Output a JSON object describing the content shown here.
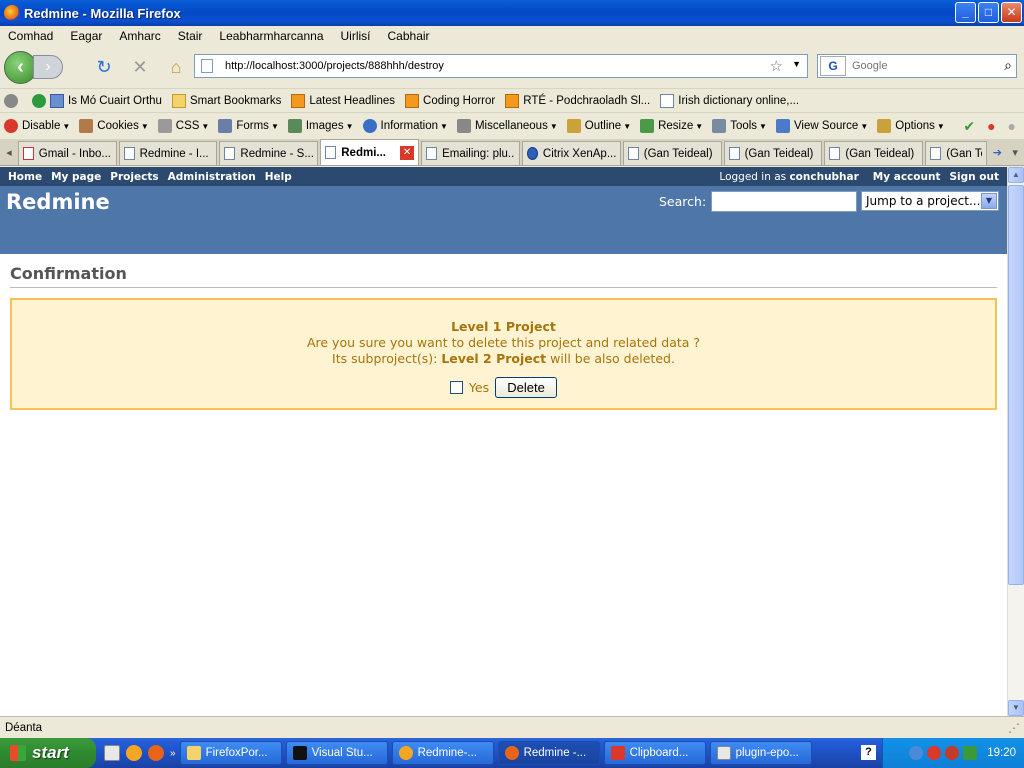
{
  "window": {
    "title": "Redmine - Mozilla Firefox",
    "minimize": "_",
    "maximize": "□",
    "close": "✕"
  },
  "menu": [
    "Comhad",
    "Eagar",
    "Amharc",
    "Stair",
    "Leabharmharcanna",
    "Uirlisí",
    "Cabhair"
  ],
  "nav": {
    "url": "http://localhost:3000/projects/888hhh/destroy",
    "search_placeholder": "Google"
  },
  "bookmarks": [
    {
      "label": "Is Mó Cuairt Orthu",
      "icon": "stumbleupon-icon"
    },
    {
      "label": "Smart Bookmarks",
      "icon": "folder-icon"
    },
    {
      "label": "Latest Headlines",
      "icon": "rss-icon"
    },
    {
      "label": "Coding Horror",
      "icon": "rss-icon"
    },
    {
      "label": "RTÉ - Podchraoladh Sl...",
      "icon": "rss-icon"
    },
    {
      "label": "Irish dictionary online,...",
      "icon": "page-icon"
    }
  ],
  "devtools": [
    {
      "label": "Disable",
      "icon": "disable-icon",
      "color": "#d9382a"
    },
    {
      "label": "Cookies",
      "icon": "cookies-icon",
      "color": "#b07a4a"
    },
    {
      "label": "CSS",
      "icon": "css-icon",
      "color": "#9a9a9a"
    },
    {
      "label": "Forms",
      "icon": "forms-icon",
      "color": "#6a7fa8"
    },
    {
      "label": "Images",
      "icon": "images-icon",
      "color": "#5a8a5a"
    },
    {
      "label": "Information",
      "icon": "information-icon",
      "color": "#3a6fc8"
    },
    {
      "label": "Miscellaneous",
      "icon": "miscellaneous-icon",
      "color": "#888888"
    },
    {
      "label": "Outline",
      "icon": "outline-icon",
      "color": "#c9a23a"
    },
    {
      "label": "Resize",
      "icon": "resize-icon",
      "color": "#4a9a4a"
    },
    {
      "label": "Tools",
      "icon": "tools-icon",
      "color": "#7a8aa0"
    },
    {
      "label": "View Source",
      "icon": "view-source-icon",
      "color": "#4a7ac8"
    },
    {
      "label": "Options",
      "icon": "options-icon",
      "color": "#c9a23a"
    }
  ],
  "tabs": [
    {
      "label": "Gmail - Inbo...",
      "icon": "gmail-icon",
      "active": false
    },
    {
      "label": "Redmine - I...",
      "icon": "page-icon",
      "active": false
    },
    {
      "label": "Redmine - S...",
      "icon": "page-icon",
      "active": false
    },
    {
      "label": "Redmi...",
      "icon": "page-icon",
      "active": true
    },
    {
      "label": "Emailing: plu...",
      "icon": "page-icon",
      "active": false
    },
    {
      "label": "Citrix XenAp...",
      "icon": "citrix-icon",
      "active": false
    },
    {
      "label": "(Gan Teideal)",
      "icon": "page-icon",
      "active": false
    },
    {
      "label": "(Gan Teideal)",
      "icon": "page-icon",
      "active": false
    },
    {
      "label": "(Gan Teideal)",
      "icon": "page-icon",
      "active": false
    },
    {
      "label": "(Gan Tei",
      "icon": "page-icon",
      "active": false
    }
  ],
  "redmine": {
    "topmenu": [
      "Home",
      "My page",
      "Projects",
      "Administration",
      "Help"
    ],
    "logged_in_prefix": "Logged in as",
    "user": "conchubhar",
    "my_account": "My account",
    "sign_out": "Sign out",
    "header_title": "Redmine",
    "search_label": "Search:",
    "jump": "Jump to a project...",
    "page_title": "Confirmation",
    "project_name": "Level 1 Project",
    "question": "Are you sure you want to delete this project and related data ?",
    "sub_prefix": "Its subproject(s):",
    "sub_name": "Level 2 Project",
    "sub_suffix": "will be also deleted.",
    "yes_label": "Yes",
    "delete_button": "Delete"
  },
  "status": "Déanta",
  "taskbar": {
    "start": "start",
    "tasks": [
      {
        "label": "FirefoxPor...",
        "icon": "folder-icon",
        "active": false
      },
      {
        "label": "Visual Stu...",
        "icon": "console-icon",
        "active": false
      },
      {
        "label": "Redmine-...",
        "icon": "web-icon",
        "active": false
      },
      {
        "label": "Redmine -...",
        "icon": "firefox-icon",
        "active": true
      },
      {
        "label": "Clipboard...",
        "icon": "clipboard-icon",
        "active": false
      },
      {
        "label": "plugin-epo...",
        "icon": "notepad-icon",
        "active": false
      }
    ],
    "clock": "19:20"
  }
}
